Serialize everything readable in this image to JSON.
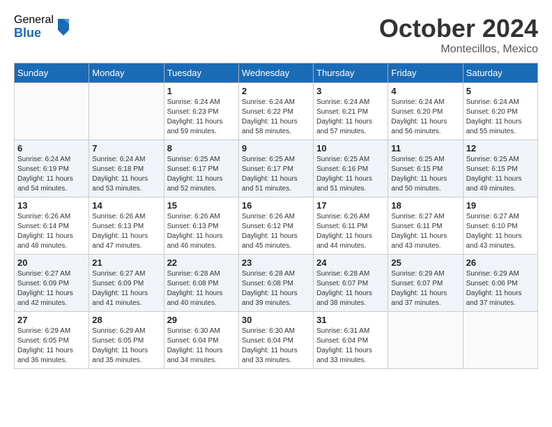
{
  "header": {
    "logo_general": "General",
    "logo_blue": "Blue",
    "month_title": "October 2024",
    "location": "Montecillos, Mexico"
  },
  "weekdays": [
    "Sunday",
    "Monday",
    "Tuesday",
    "Wednesday",
    "Thursday",
    "Friday",
    "Saturday"
  ],
  "weeks": [
    [
      {
        "day": "",
        "sunrise": "",
        "sunset": "",
        "daylight": ""
      },
      {
        "day": "",
        "sunrise": "",
        "sunset": "",
        "daylight": ""
      },
      {
        "day": "1",
        "sunrise": "Sunrise: 6:24 AM",
        "sunset": "Sunset: 6:23 PM",
        "daylight": "Daylight: 11 hours and 59 minutes."
      },
      {
        "day": "2",
        "sunrise": "Sunrise: 6:24 AM",
        "sunset": "Sunset: 6:22 PM",
        "daylight": "Daylight: 11 hours and 58 minutes."
      },
      {
        "day": "3",
        "sunrise": "Sunrise: 6:24 AM",
        "sunset": "Sunset: 6:21 PM",
        "daylight": "Daylight: 11 hours and 57 minutes."
      },
      {
        "day": "4",
        "sunrise": "Sunrise: 6:24 AM",
        "sunset": "Sunset: 6:20 PM",
        "daylight": "Daylight: 11 hours and 56 minutes."
      },
      {
        "day": "5",
        "sunrise": "Sunrise: 6:24 AM",
        "sunset": "Sunset: 6:20 PM",
        "daylight": "Daylight: 11 hours and 55 minutes."
      }
    ],
    [
      {
        "day": "6",
        "sunrise": "Sunrise: 6:24 AM",
        "sunset": "Sunset: 6:19 PM",
        "daylight": "Daylight: 11 hours and 54 minutes."
      },
      {
        "day": "7",
        "sunrise": "Sunrise: 6:24 AM",
        "sunset": "Sunset: 6:18 PM",
        "daylight": "Daylight: 11 hours and 53 minutes."
      },
      {
        "day": "8",
        "sunrise": "Sunrise: 6:25 AM",
        "sunset": "Sunset: 6:17 PM",
        "daylight": "Daylight: 11 hours and 52 minutes."
      },
      {
        "day": "9",
        "sunrise": "Sunrise: 6:25 AM",
        "sunset": "Sunset: 6:17 PM",
        "daylight": "Daylight: 11 hours and 51 minutes."
      },
      {
        "day": "10",
        "sunrise": "Sunrise: 6:25 AM",
        "sunset": "Sunset: 6:16 PM",
        "daylight": "Daylight: 11 hours and 51 minutes."
      },
      {
        "day": "11",
        "sunrise": "Sunrise: 6:25 AM",
        "sunset": "Sunset: 6:15 PM",
        "daylight": "Daylight: 11 hours and 50 minutes."
      },
      {
        "day": "12",
        "sunrise": "Sunrise: 6:25 AM",
        "sunset": "Sunset: 6:15 PM",
        "daylight": "Daylight: 11 hours and 49 minutes."
      }
    ],
    [
      {
        "day": "13",
        "sunrise": "Sunrise: 6:26 AM",
        "sunset": "Sunset: 6:14 PM",
        "daylight": "Daylight: 11 hours and 48 minutes."
      },
      {
        "day": "14",
        "sunrise": "Sunrise: 6:26 AM",
        "sunset": "Sunset: 6:13 PM",
        "daylight": "Daylight: 11 hours and 47 minutes."
      },
      {
        "day": "15",
        "sunrise": "Sunrise: 6:26 AM",
        "sunset": "Sunset: 6:13 PM",
        "daylight": "Daylight: 11 hours and 46 minutes."
      },
      {
        "day": "16",
        "sunrise": "Sunrise: 6:26 AM",
        "sunset": "Sunset: 6:12 PM",
        "daylight": "Daylight: 11 hours and 45 minutes."
      },
      {
        "day": "17",
        "sunrise": "Sunrise: 6:26 AM",
        "sunset": "Sunset: 6:11 PM",
        "daylight": "Daylight: 11 hours and 44 minutes."
      },
      {
        "day": "18",
        "sunrise": "Sunrise: 6:27 AM",
        "sunset": "Sunset: 6:11 PM",
        "daylight": "Daylight: 11 hours and 43 minutes."
      },
      {
        "day": "19",
        "sunrise": "Sunrise: 6:27 AM",
        "sunset": "Sunset: 6:10 PM",
        "daylight": "Daylight: 11 hours and 43 minutes."
      }
    ],
    [
      {
        "day": "20",
        "sunrise": "Sunrise: 6:27 AM",
        "sunset": "Sunset: 6:09 PM",
        "daylight": "Daylight: 11 hours and 42 minutes."
      },
      {
        "day": "21",
        "sunrise": "Sunrise: 6:27 AM",
        "sunset": "Sunset: 6:09 PM",
        "daylight": "Daylight: 11 hours and 41 minutes."
      },
      {
        "day": "22",
        "sunrise": "Sunrise: 6:28 AM",
        "sunset": "Sunset: 6:08 PM",
        "daylight": "Daylight: 11 hours and 40 minutes."
      },
      {
        "day": "23",
        "sunrise": "Sunrise: 6:28 AM",
        "sunset": "Sunset: 6:08 PM",
        "daylight": "Daylight: 11 hours and 39 minutes."
      },
      {
        "day": "24",
        "sunrise": "Sunrise: 6:28 AM",
        "sunset": "Sunset: 6:07 PM",
        "daylight": "Daylight: 11 hours and 38 minutes."
      },
      {
        "day": "25",
        "sunrise": "Sunrise: 6:29 AM",
        "sunset": "Sunset: 6:07 PM",
        "daylight": "Daylight: 11 hours and 37 minutes."
      },
      {
        "day": "26",
        "sunrise": "Sunrise: 6:29 AM",
        "sunset": "Sunset: 6:06 PM",
        "daylight": "Daylight: 11 hours and 37 minutes."
      }
    ],
    [
      {
        "day": "27",
        "sunrise": "Sunrise: 6:29 AM",
        "sunset": "Sunset: 6:05 PM",
        "daylight": "Daylight: 11 hours and 36 minutes."
      },
      {
        "day": "28",
        "sunrise": "Sunrise: 6:29 AM",
        "sunset": "Sunset: 6:05 PM",
        "daylight": "Daylight: 11 hours and 35 minutes."
      },
      {
        "day": "29",
        "sunrise": "Sunrise: 6:30 AM",
        "sunset": "Sunset: 6:04 PM",
        "daylight": "Daylight: 11 hours and 34 minutes."
      },
      {
        "day": "30",
        "sunrise": "Sunrise: 6:30 AM",
        "sunset": "Sunset: 6:04 PM",
        "daylight": "Daylight: 11 hours and 33 minutes."
      },
      {
        "day": "31",
        "sunrise": "Sunrise: 6:31 AM",
        "sunset": "Sunset: 6:04 PM",
        "daylight": "Daylight: 11 hours and 33 minutes."
      },
      {
        "day": "",
        "sunrise": "",
        "sunset": "",
        "daylight": ""
      },
      {
        "day": "",
        "sunrise": "",
        "sunset": "",
        "daylight": ""
      }
    ]
  ]
}
